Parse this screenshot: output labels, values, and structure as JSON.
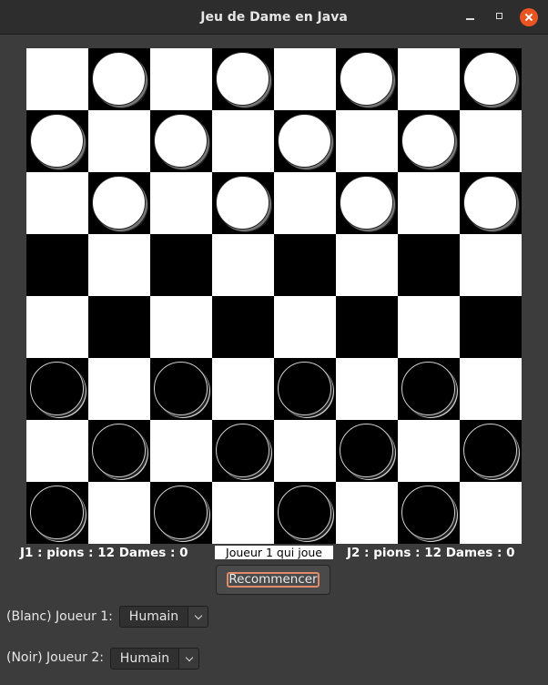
{
  "window": {
    "title": "Jeu de Dame en Java"
  },
  "board": {
    "rows": [
      [
        "light",
        "dark:white",
        "light",
        "dark:white",
        "light",
        "dark:white",
        "light",
        "dark:white"
      ],
      [
        "dark:white",
        "light",
        "dark:white",
        "light",
        "dark:white",
        "light",
        "dark:white",
        "light"
      ],
      [
        "light",
        "dark:white",
        "light",
        "dark:white",
        "light",
        "dark:white",
        "light",
        "dark:white"
      ],
      [
        "dark",
        "light",
        "dark",
        "light",
        "dark",
        "light",
        "dark",
        "light"
      ],
      [
        "light",
        "dark",
        "light",
        "dark",
        "light",
        "dark",
        "light",
        "dark"
      ],
      [
        "dark:black",
        "light",
        "dark:black",
        "light",
        "dark:black",
        "light",
        "dark:black",
        "light"
      ],
      [
        "light",
        "dark:black",
        "light",
        "dark:black",
        "light",
        "dark:black",
        "light",
        "dark:black"
      ],
      [
        "dark:black",
        "light",
        "dark:black",
        "light",
        "dark:black",
        "light",
        "dark:black",
        "light"
      ]
    ]
  },
  "status": {
    "j1": "J1 : pions : 12 Dames : 0",
    "turn": "Joueur 1 qui joue",
    "j2": "J2 : pions : 12 Dames : 0"
  },
  "controls": {
    "restart_label": "Recommencer",
    "player1_label": "(Blanc) Joueur 1:",
    "player1_value": "Humain",
    "player2_label": "(Noir) Joueur 2:",
    "player2_value": "Humain"
  },
  "icons": {
    "minimize": "minimize-icon",
    "maximize": "maximize-icon",
    "close": "close-icon",
    "dropdown": "chevron-down-icon"
  },
  "colors": {
    "close_button": "#e95420",
    "focus_ring": "#e08a6a",
    "background": "#3c3c3c"
  }
}
